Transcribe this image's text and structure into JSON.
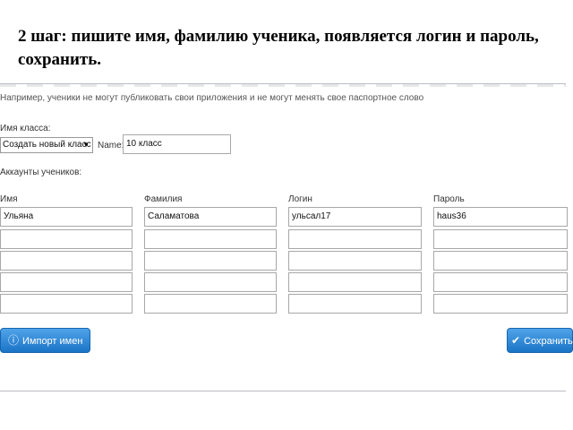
{
  "heading": "2 шаг: пишите имя, фамилию ученика, появляется логин и пароль, сохранить.",
  "note": "Например, ученики не могут публиковать свои приложения и не могут менять свое паспортное слово",
  "class_section": {
    "label": "Имя класса:",
    "select_value": "Создать новый класс",
    "name_label": "Name:",
    "name_value": "10 класс"
  },
  "accounts_label": "Аккаунты учеников:",
  "columns": {
    "first_name": "Имя",
    "last_name": "Фамилия",
    "login": "Логин",
    "password": "Пароль"
  },
  "rows": [
    {
      "first_name": "Ульяна",
      "last_name": "Саламатова",
      "login": "ульсал17",
      "password": "haus36"
    },
    {
      "first_name": "",
      "last_name": "",
      "login": "",
      "password": ""
    },
    {
      "first_name": "",
      "last_name": "",
      "login": "",
      "password": ""
    },
    {
      "first_name": "",
      "last_name": "",
      "login": "",
      "password": ""
    },
    {
      "first_name": "",
      "last_name": "",
      "login": "",
      "password": ""
    }
  ],
  "buttons": {
    "import": "Импорт имен",
    "save": "Сохранить"
  },
  "icons": {
    "import": "info-circle-icon",
    "save": "checkmark-icon",
    "select": "dropdown-arrow-icon"
  },
  "colors": {
    "button": "#1b74c6"
  }
}
